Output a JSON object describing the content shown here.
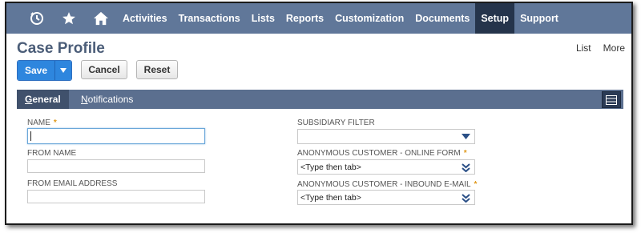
{
  "nav": {
    "icons": [
      "recent-history-icon",
      "star-icon",
      "home-icon"
    ],
    "items": [
      "Activities",
      "Transactions",
      "Lists",
      "Reports",
      "Customization",
      "Documents",
      "Setup",
      "Support"
    ],
    "active": "Setup"
  },
  "page": {
    "title": "Case Profile",
    "links": [
      "List",
      "More"
    ]
  },
  "buttons": {
    "save": "Save",
    "cancel": "Cancel",
    "reset": "Reset"
  },
  "tabs": {
    "general": {
      "underlined": "G",
      "rest": "eneral"
    },
    "notifications": {
      "underlined": "N",
      "rest": "otifications"
    }
  },
  "form": {
    "name": {
      "label": "NAME",
      "required": "*",
      "value": ""
    },
    "from_name": {
      "label": "FROM NAME",
      "value": ""
    },
    "from_email": {
      "label": "FROM EMAIL ADDRESS",
      "value": ""
    },
    "subsidiary_filter": {
      "label": "SUBSIDIARY FILTER",
      "value": ""
    },
    "anon_online": {
      "label": "ANONYMOUS CUSTOMER - ONLINE FORM",
      "required": "*",
      "value": "<Type then tab>"
    },
    "anon_email": {
      "label": "ANONYMOUS CUSTOMER - INBOUND E-MAIL",
      "required": "*",
      "value": "<Type then tab>"
    }
  },
  "colors": {
    "navbar": "#607799",
    "nav_active": "#25344b",
    "primary_button": "#2e86de",
    "title": "#4b5d78",
    "required": "#e09a1c"
  }
}
